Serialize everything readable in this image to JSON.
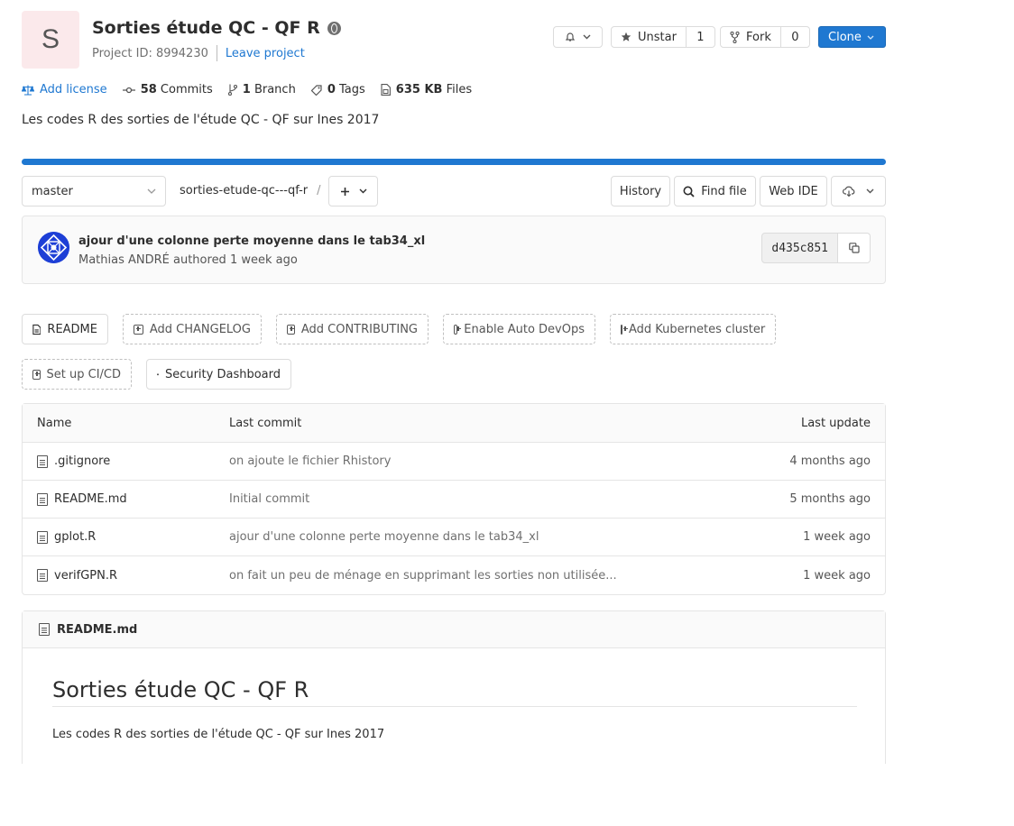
{
  "project": {
    "avatar_letter": "S",
    "title": "Sorties étude QC - QF R",
    "id_label": "Project ID: 8994230",
    "leave": "Leave project",
    "description": "Les codes R des sorties de l'étude QC - QF sur Ines 2017"
  },
  "actions": {
    "unstar_label": "Unstar",
    "star_count": "1",
    "fork_label": "Fork",
    "fork_count": "0",
    "clone_label": "Clone"
  },
  "stats": {
    "license": "Add license",
    "commits_count": "58",
    "commits_label": "Commits",
    "branch_count": "1",
    "branch_label": "Branch",
    "tags_count": "0",
    "tags_label": "Tags",
    "files_size": "635 KB",
    "files_label": "Files"
  },
  "toolbar": {
    "branch": "master",
    "path": "sorties-etude-qc---qf-r",
    "slash": "/",
    "history": "History",
    "find_file": "Find file",
    "web_ide": "Web IDE"
  },
  "last_commit": {
    "title": "ajour d'une colonne perte moyenne dans le tab34_xl",
    "author_line": "Mathias ANDRÉ authored 1 week ago",
    "sha": "d435c851"
  },
  "quick_links": {
    "readme": "README",
    "changelog": "Add CHANGELOG",
    "contributing": "Add CONTRIBUTING",
    "autodevops": "Enable Auto DevOps",
    "kubernetes": "Add Kubernetes cluster",
    "cicd": "Set up CI/CD",
    "security": "Security Dashboard"
  },
  "table": {
    "headers": {
      "name": "Name",
      "commit": "Last commit",
      "update": "Last update"
    },
    "rows": [
      {
        "name": ".gitignore",
        "commit": "on ajoute le fichier Rhistory",
        "update": "4 months ago"
      },
      {
        "name": "README.md",
        "commit": "Initial commit",
        "update": "5 months ago"
      },
      {
        "name": "gplot.R",
        "commit": "ajour d'une colonne perte moyenne dans le tab34_xl",
        "update": "1 week ago"
      },
      {
        "name": "verifGPN.R",
        "commit": "on fait un peu de ménage en supprimant les sorties non utilisée...",
        "update": "1 week ago"
      }
    ]
  },
  "readme": {
    "file_name": "README.md",
    "heading": "Sorties étude QC - QF R",
    "body": "Les codes R des sorties de l'étude QC - QF sur Ines 2017"
  },
  "colors": {
    "accent": "#1f78d1",
    "avatar_bg": "#fbe9eb",
    "commit_avatar": "#1d3fd6"
  }
}
